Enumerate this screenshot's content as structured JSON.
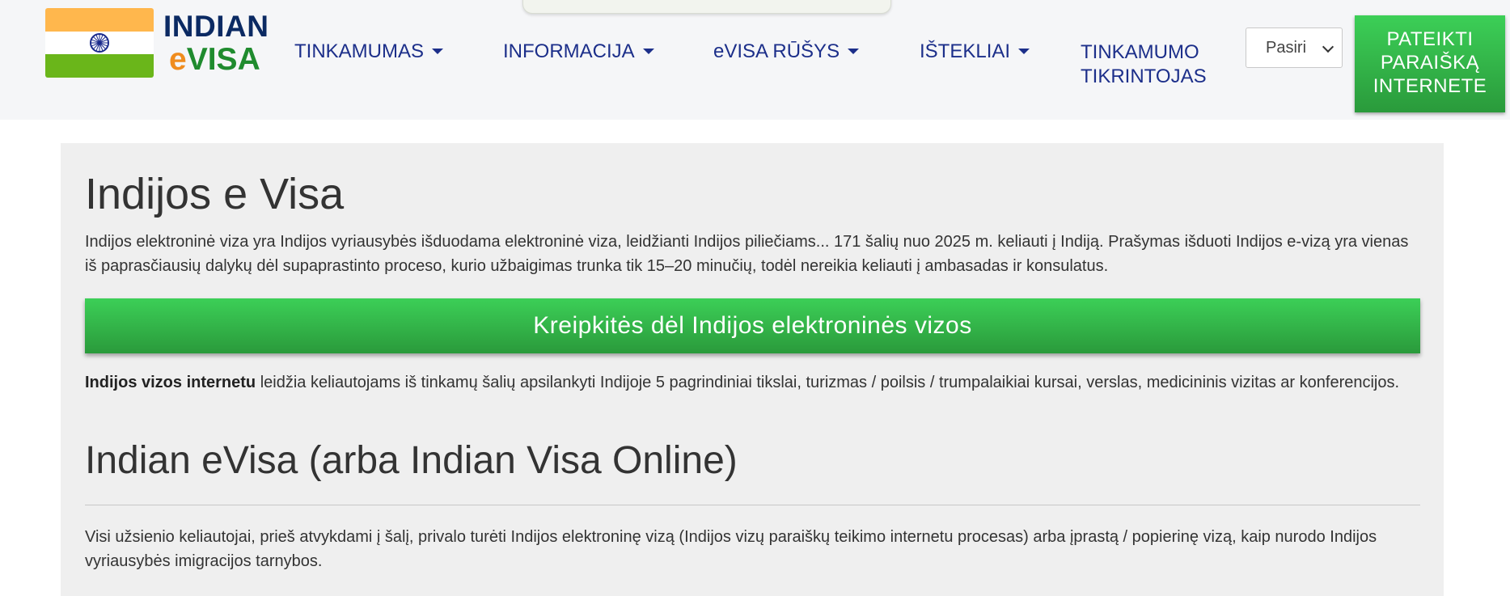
{
  "header": {
    "logo": {
      "line1": "INDIAN",
      "line2_e": "e",
      "line2_visa": "VISA",
      "flag_icon": "india-flag-icon"
    },
    "nav": [
      {
        "label": "TINKAMUMAS",
        "dropdown": true
      },
      {
        "label": "INFORMACIJA",
        "dropdown": true
      },
      {
        "label": "eVISA RŪŠYS",
        "dropdown": true
      },
      {
        "label": "IŠTEKLIAI",
        "dropdown": true
      },
      {
        "label": "TINKAMUMO TIKRINTOJAS",
        "dropdown": false
      }
    ],
    "language_select": {
      "selected": "Pasiri"
    },
    "apply_button": "PATEIKTI PARAIŠKĄ INTERNETE"
  },
  "main": {
    "title": "Indijos e Visa",
    "intro": "Indijos elektroninė viza yra Indijos vyriausybės išduodama elektroninė viza, leidžianti Indijos piliečiams... 171 šalių nuo 2025 m. keliauti į Indiją. Prašymas išduoti Indijos e-vizą yra vienas iš paprasčiausių dalykų dėl supaprastinto proceso, kurio užbaigimas trunka tik 15–20 minučių, todėl nereikia keliauti į ambasadas ir konsulatus.",
    "apply_button": "Kreipkitės dėl Indijos elektroninės vizos",
    "para2_bold": "Indijos vizos internetu",
    "para2_rest": " leidžia keliautojams iš tinkamų šalių apsilankyti Indijoje 5 pagrindiniai tikslai, turizmas / poilsis / trumpalaikiai kursai, verslas, medicininis vizitas ar konferencijos.",
    "subtitle": "Indian eVisa (arba Indian Visa Online)",
    "para3": "Visi užsienio keliautojai, prieš atvykdami į šalį, privalo turėti Indijos elektroninę vizą (Indijos vizų paraiškų teikimo internetu procesas) arba įprastą / popierinę vizą, kaip nurodo Indijos vyriausybės imigracijos tarnybos."
  },
  "colors": {
    "nav_text": "#1c2f8a",
    "button_green": "#3ccf57",
    "logo_blue": "#0b2a63",
    "logo_orange": "#f08c1e",
    "logo_green": "#1f8b2e"
  }
}
